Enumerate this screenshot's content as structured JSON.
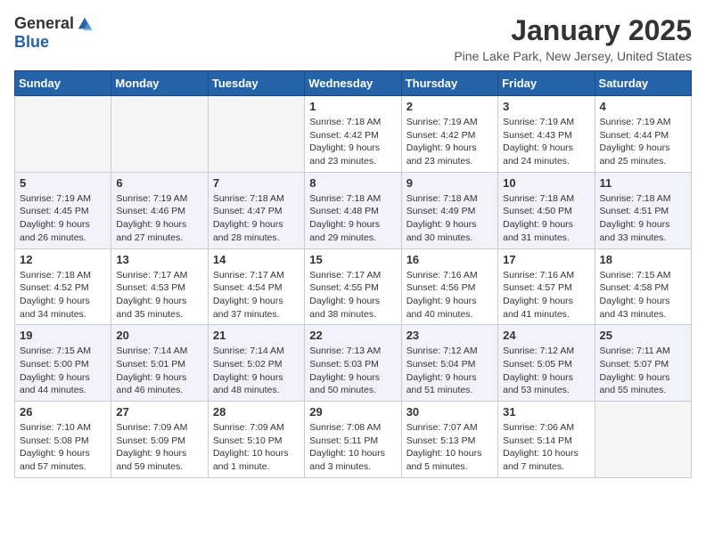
{
  "logo": {
    "general": "General",
    "blue": "Blue"
  },
  "title": "January 2025",
  "location": "Pine Lake Park, New Jersey, United States",
  "weekdays": [
    "Sunday",
    "Monday",
    "Tuesday",
    "Wednesday",
    "Thursday",
    "Friday",
    "Saturday"
  ],
  "weeks": [
    [
      {
        "day": "",
        "info": ""
      },
      {
        "day": "",
        "info": ""
      },
      {
        "day": "",
        "info": ""
      },
      {
        "day": "1",
        "info": "Sunrise: 7:18 AM\nSunset: 4:42 PM\nDaylight: 9 hours and 23 minutes."
      },
      {
        "day": "2",
        "info": "Sunrise: 7:19 AM\nSunset: 4:42 PM\nDaylight: 9 hours and 23 minutes."
      },
      {
        "day": "3",
        "info": "Sunrise: 7:19 AM\nSunset: 4:43 PM\nDaylight: 9 hours and 24 minutes."
      },
      {
        "day": "4",
        "info": "Sunrise: 7:19 AM\nSunset: 4:44 PM\nDaylight: 9 hours and 25 minutes."
      }
    ],
    [
      {
        "day": "5",
        "info": "Sunrise: 7:19 AM\nSunset: 4:45 PM\nDaylight: 9 hours and 26 minutes."
      },
      {
        "day": "6",
        "info": "Sunrise: 7:19 AM\nSunset: 4:46 PM\nDaylight: 9 hours and 27 minutes."
      },
      {
        "day": "7",
        "info": "Sunrise: 7:18 AM\nSunset: 4:47 PM\nDaylight: 9 hours and 28 minutes."
      },
      {
        "day": "8",
        "info": "Sunrise: 7:18 AM\nSunset: 4:48 PM\nDaylight: 9 hours and 29 minutes."
      },
      {
        "day": "9",
        "info": "Sunrise: 7:18 AM\nSunset: 4:49 PM\nDaylight: 9 hours and 30 minutes."
      },
      {
        "day": "10",
        "info": "Sunrise: 7:18 AM\nSunset: 4:50 PM\nDaylight: 9 hours and 31 minutes."
      },
      {
        "day": "11",
        "info": "Sunrise: 7:18 AM\nSunset: 4:51 PM\nDaylight: 9 hours and 33 minutes."
      }
    ],
    [
      {
        "day": "12",
        "info": "Sunrise: 7:18 AM\nSunset: 4:52 PM\nDaylight: 9 hours and 34 minutes."
      },
      {
        "day": "13",
        "info": "Sunrise: 7:17 AM\nSunset: 4:53 PM\nDaylight: 9 hours and 35 minutes."
      },
      {
        "day": "14",
        "info": "Sunrise: 7:17 AM\nSunset: 4:54 PM\nDaylight: 9 hours and 37 minutes."
      },
      {
        "day": "15",
        "info": "Sunrise: 7:17 AM\nSunset: 4:55 PM\nDaylight: 9 hours and 38 minutes."
      },
      {
        "day": "16",
        "info": "Sunrise: 7:16 AM\nSunset: 4:56 PM\nDaylight: 9 hours and 40 minutes."
      },
      {
        "day": "17",
        "info": "Sunrise: 7:16 AM\nSunset: 4:57 PM\nDaylight: 9 hours and 41 minutes."
      },
      {
        "day": "18",
        "info": "Sunrise: 7:15 AM\nSunset: 4:58 PM\nDaylight: 9 hours and 43 minutes."
      }
    ],
    [
      {
        "day": "19",
        "info": "Sunrise: 7:15 AM\nSunset: 5:00 PM\nDaylight: 9 hours and 44 minutes."
      },
      {
        "day": "20",
        "info": "Sunrise: 7:14 AM\nSunset: 5:01 PM\nDaylight: 9 hours and 46 minutes."
      },
      {
        "day": "21",
        "info": "Sunrise: 7:14 AM\nSunset: 5:02 PM\nDaylight: 9 hours and 48 minutes."
      },
      {
        "day": "22",
        "info": "Sunrise: 7:13 AM\nSunset: 5:03 PM\nDaylight: 9 hours and 50 minutes."
      },
      {
        "day": "23",
        "info": "Sunrise: 7:12 AM\nSunset: 5:04 PM\nDaylight: 9 hours and 51 minutes."
      },
      {
        "day": "24",
        "info": "Sunrise: 7:12 AM\nSunset: 5:05 PM\nDaylight: 9 hours and 53 minutes."
      },
      {
        "day": "25",
        "info": "Sunrise: 7:11 AM\nSunset: 5:07 PM\nDaylight: 9 hours and 55 minutes."
      }
    ],
    [
      {
        "day": "26",
        "info": "Sunrise: 7:10 AM\nSunset: 5:08 PM\nDaylight: 9 hours and 57 minutes."
      },
      {
        "day": "27",
        "info": "Sunrise: 7:09 AM\nSunset: 5:09 PM\nDaylight: 9 hours and 59 minutes."
      },
      {
        "day": "28",
        "info": "Sunrise: 7:09 AM\nSunset: 5:10 PM\nDaylight: 10 hours and 1 minute."
      },
      {
        "day": "29",
        "info": "Sunrise: 7:08 AM\nSunset: 5:11 PM\nDaylight: 10 hours and 3 minutes."
      },
      {
        "day": "30",
        "info": "Sunrise: 7:07 AM\nSunset: 5:13 PM\nDaylight: 10 hours and 5 minutes."
      },
      {
        "day": "31",
        "info": "Sunrise: 7:06 AM\nSunset: 5:14 PM\nDaylight: 10 hours and 7 minutes."
      },
      {
        "day": "",
        "info": ""
      }
    ]
  ]
}
